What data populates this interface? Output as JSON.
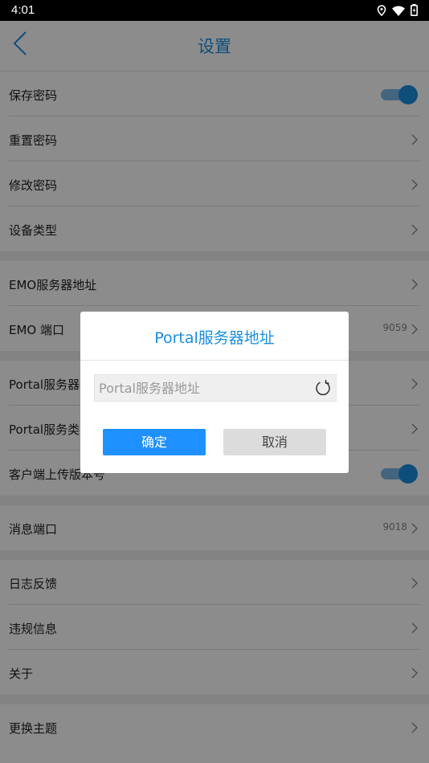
{
  "status_bar": {
    "time": "4:01",
    "icons": [
      "location-icon",
      "wifi-icon",
      "battery-icon"
    ]
  },
  "header": {
    "title": "设置"
  },
  "settings": {
    "save_password": "保存密码",
    "reset_password": "重置密码",
    "change_password": "修改密码",
    "device_type": "设备类型",
    "emo_server_address": "EMO服务器地址",
    "emo_port": "EMO 端口",
    "emo_port_value": "9059",
    "portal_server": "Portal服务器",
    "portal_service_type": "Portal服务类",
    "client_upload_version": "客户端上传版本号",
    "message_port": "消息端口",
    "message_port_value": "9018",
    "log_feedback": "日志反馈",
    "violation_info": "违规信息",
    "about": "关于",
    "change_theme": "更换主题"
  },
  "dialog": {
    "title": "Portal服务器地址",
    "input_value": "",
    "input_placeholder": "Portal服务器地址",
    "ok_label": "确定",
    "cancel_label": "取消"
  },
  "colors": {
    "accent": "#1a8fe0",
    "ok_button": "#1e90ff",
    "toggle_track": "#7fb6e6"
  }
}
